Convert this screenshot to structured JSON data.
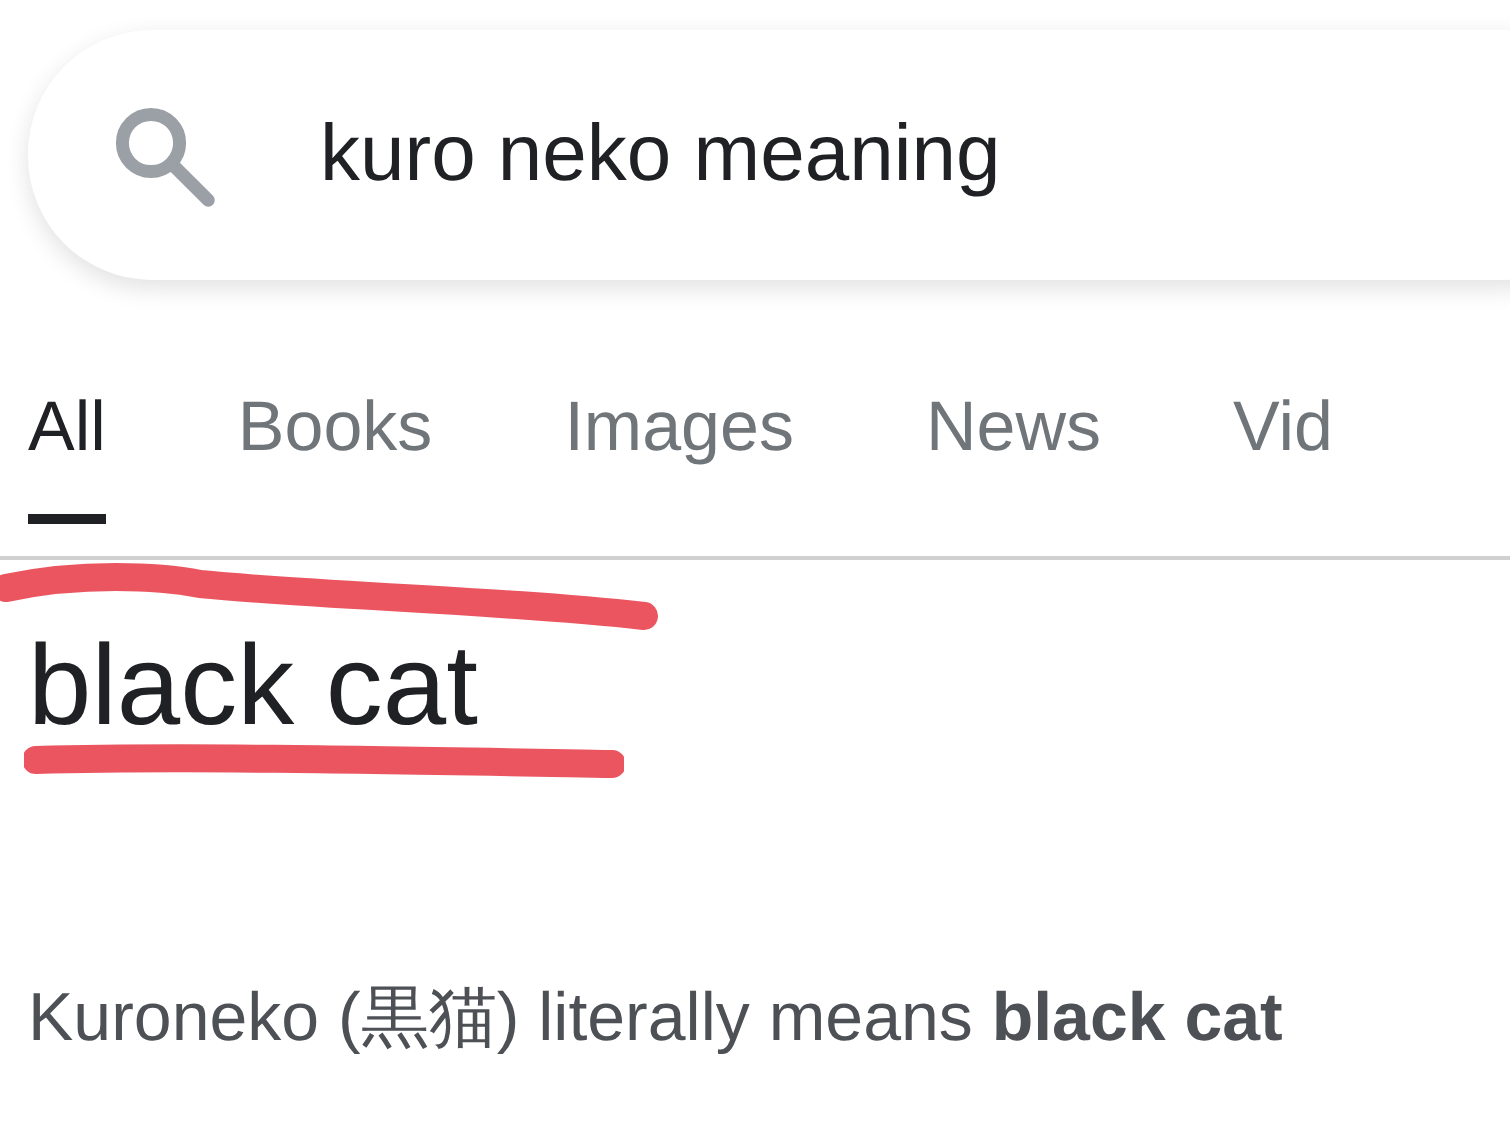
{
  "search": {
    "value": "kuro neko meaning"
  },
  "tabs": [
    {
      "label": "All",
      "selected": true
    },
    {
      "label": "Books",
      "selected": false
    },
    {
      "label": "Images",
      "selected": false
    },
    {
      "label": "News",
      "selected": false
    },
    {
      "label": "Vid",
      "selected": false
    }
  ],
  "answer": {
    "title": "black cat",
    "snippet": "Kuroneko (黒猫) literally means **black cat**"
  }
}
